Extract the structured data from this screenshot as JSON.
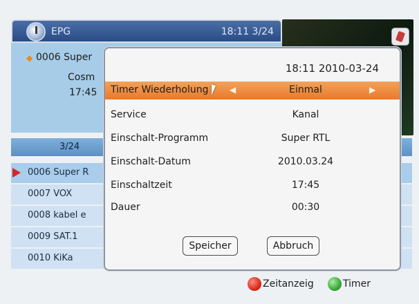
{
  "epg": {
    "title": "EPG",
    "time_page": "18:11 3/24"
  },
  "info": {
    "line1": "0006 Super",
    "line2": "Cosm",
    "line3": "17:45"
  },
  "page_indicator": "3/24",
  "channels": [
    {
      "label": "0006 Super R"
    },
    {
      "label": "0007 VOX"
    },
    {
      "label": "0008 kabel e"
    },
    {
      "label": "0009 SAT.1"
    },
    {
      "label": "0010 KiKa"
    }
  ],
  "footer": {
    "red_label": "Zeitanzeig",
    "green_label": "Timer"
  },
  "dialog": {
    "datetime": "18:11 2010-03-24",
    "rows": [
      {
        "label": "Timer Wiederholung",
        "value": "Einmal"
      },
      {
        "label": "Service",
        "value": "Kanal"
      },
      {
        "label": "Einschalt-Programm",
        "value": "Super RTL"
      },
      {
        "label": "Einschalt-Datum",
        "value": "2010.03.24"
      },
      {
        "label": "Einschaltzeit",
        "value": "17:45"
      },
      {
        "label": "Dauer",
        "value": "00:30"
      }
    ],
    "save_label": "Speicher",
    "cancel_label": "Abbruch"
  },
  "colors": {
    "highlight": "#e9792a",
    "header": "#2a4c86",
    "info_panel": "#a7cce8"
  }
}
